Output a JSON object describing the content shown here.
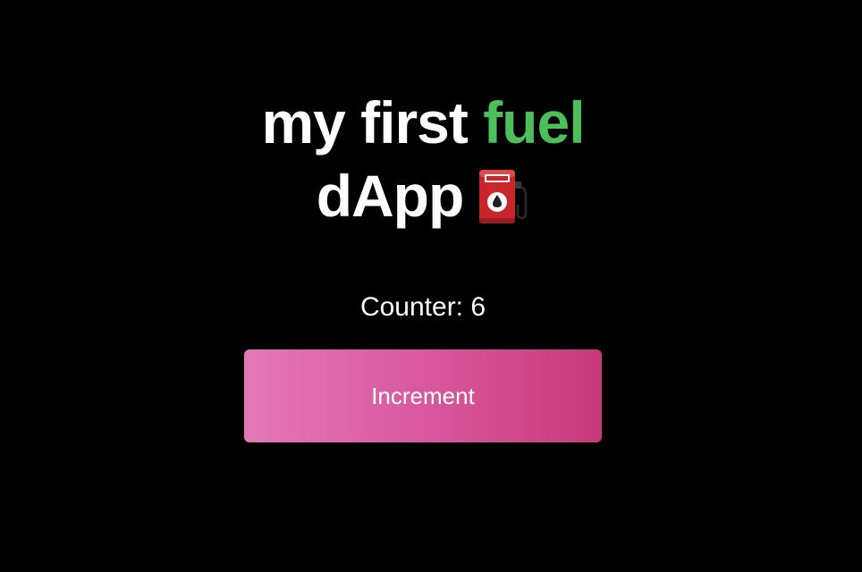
{
  "title": {
    "line1_prefix": "my first",
    "line1_accent": "fuel",
    "line2": "dApp",
    "icon": "fuel-pump-icon",
    "accent_color": "#4cbe5c"
  },
  "counter": {
    "label": "Counter: 6",
    "value": 6
  },
  "increment_button": {
    "label": "Increment",
    "gradient_colors": [
      "#e479b6",
      "#c73a79"
    ]
  },
  "background_color": "#000000"
}
